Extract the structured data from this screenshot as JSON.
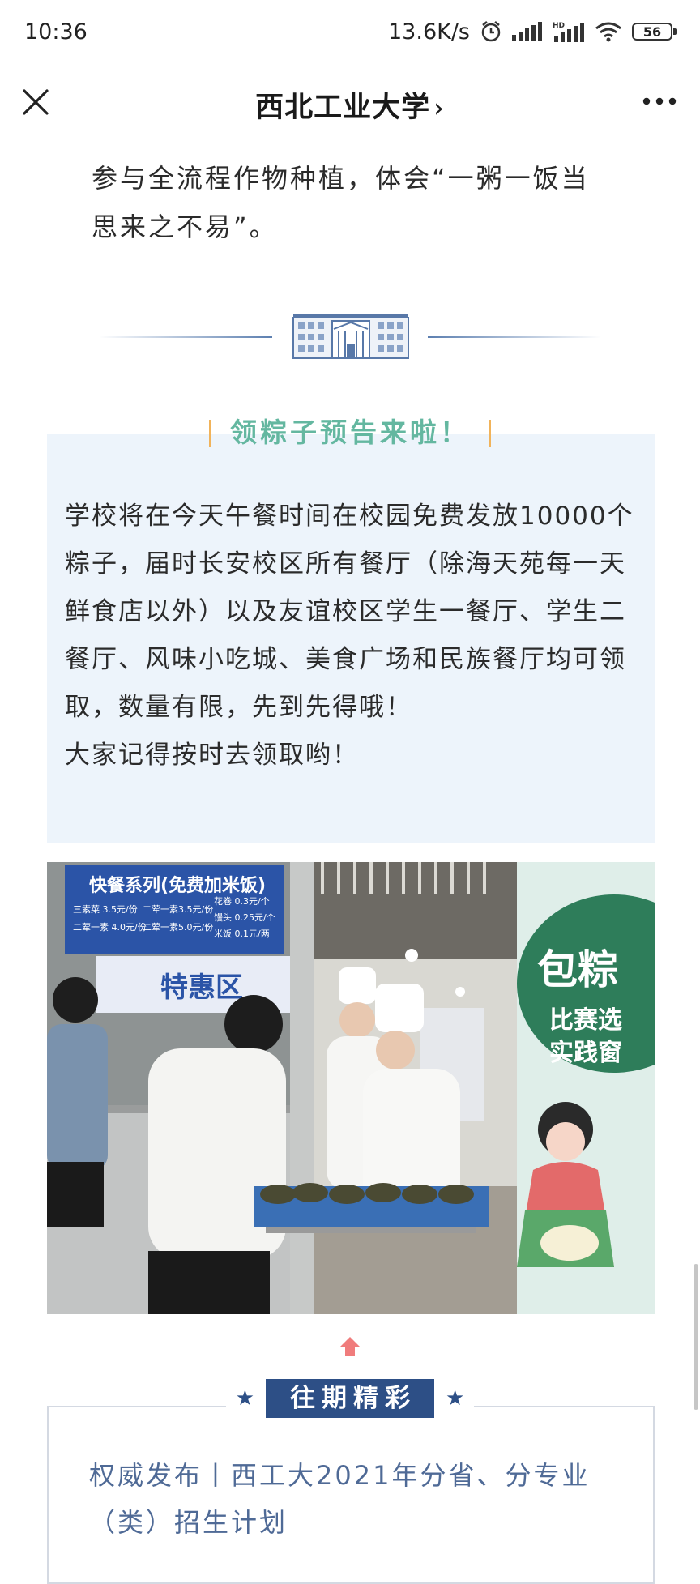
{
  "status_bar": {
    "time": "10:36",
    "speed": "13.6K/s",
    "battery": "56",
    "network": "HD"
  },
  "nav": {
    "title": "西北工业大学",
    "chevron": "›"
  },
  "article": {
    "intro": "参与全流程作物种植，体会“一粥一饭当思来之不易”。",
    "notice": {
      "title": "领粽子预告来啦！",
      "paragraph": "学校将在今天午餐时间在校园免费发放10000个粽子，届时长安校区所有餐厅（除海天苑每一天鲜食店以外）以及友谊校区学生一餐厅、学生二餐厅、风味小吃城、美食广场和民族餐厅均可领取，数量有限，先到先得哦！",
      "closing": "大家记得按时去领取哟！"
    },
    "photo": {
      "menu_board_title": "快餐系列(免费加米饭)",
      "menu_lines": [
        "三素菜 3.5元/份",
        "二荤一素3.5元/份",
        "二荤一素 4.0元/份",
        "二荤一素5.0元/份"
      ],
      "menu_prices": [
        "花卷 0.3元/个",
        "馒头 0.25元/个",
        "米饭 0.1元/两"
      ],
      "window_sign": "特惠区",
      "banner_lines": [
        "包粽",
        "比赛选",
        "实践窗"
      ]
    }
  },
  "past_highlights": {
    "header": "往期精彩",
    "star": "★",
    "items": [
      {
        "title": "权威发布丨西工大2021年分省、分专业（类）招生计划"
      }
    ]
  },
  "colors": {
    "notice_bg": "#edf4fb",
    "notice_title": "#64b7a0",
    "accent_blue": "#2d4f86",
    "link_text": "#4f6a96"
  }
}
